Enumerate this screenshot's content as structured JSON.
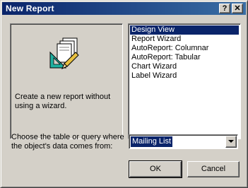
{
  "window": {
    "title": "New Report",
    "help_label": "?",
    "close_label": "✕"
  },
  "preview": {
    "icon": "report-design-icon",
    "description": "Create a new report without using a wizard."
  },
  "list": {
    "items": [
      "Design View",
      "Report Wizard",
      "AutoReport:  Columnar",
      "AutoReport:  Tabular",
      "Chart Wizard",
      "Label Wizard"
    ],
    "selected_index": 0
  },
  "source": {
    "label": "Choose the table or query where the object's data comes from:",
    "value": "Mailing List"
  },
  "buttons": {
    "ok": "OK",
    "cancel": "Cancel"
  },
  "colors": {
    "title_bar": "#0a246a",
    "selection": "#0a246a",
    "face": "#d4d0c8"
  }
}
